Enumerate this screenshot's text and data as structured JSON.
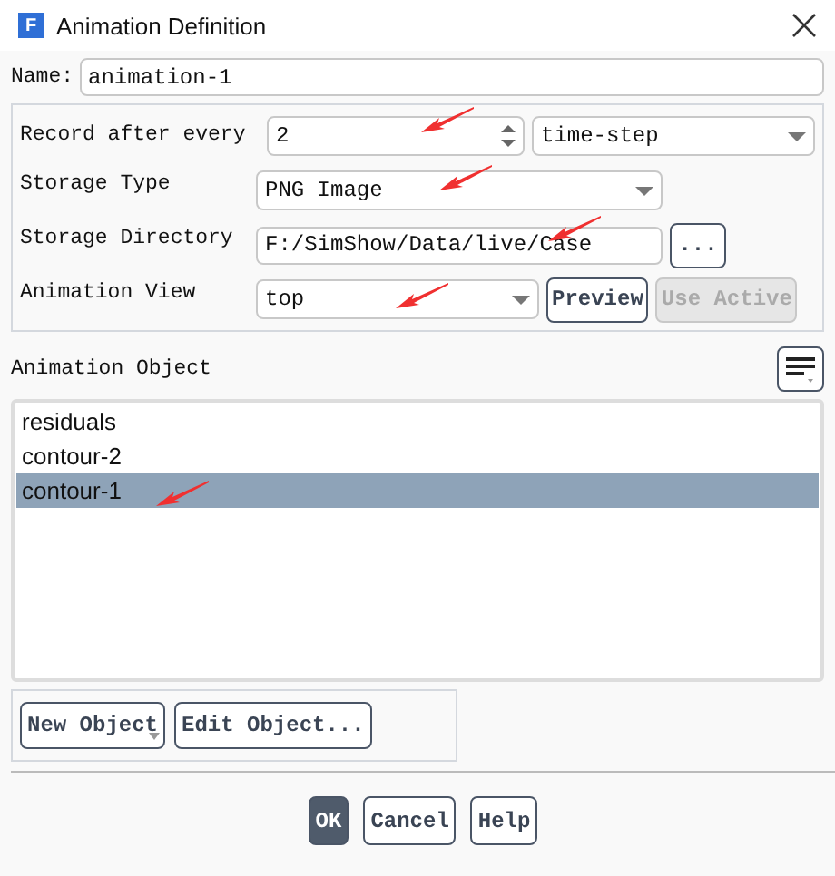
{
  "window": {
    "title": "Animation Definition",
    "app_icon": "F"
  },
  "name": {
    "label": "Name:",
    "value": "animation-1"
  },
  "record": {
    "label": "Record after every",
    "value": "2",
    "unit": "time-step"
  },
  "storage_type": {
    "label": "Storage Type",
    "value": "PNG Image"
  },
  "storage_directory": {
    "label": "Storage Directory",
    "value": "F:/SimShow/Data/live/Case",
    "browse": "..."
  },
  "animation_view": {
    "label": "Animation View",
    "value": "top",
    "buttons": [
      {
        "label": "Preview",
        "disabled": false
      },
      {
        "label": "Use Active",
        "disabled": true
      }
    ]
  },
  "object_list": {
    "label": "Animation Object",
    "items": [
      {
        "label": "residuals",
        "selected": false
      },
      {
        "label": "contour-2",
        "selected": false
      },
      {
        "label": "contour-1",
        "selected": true
      }
    ]
  },
  "object_buttons": [
    {
      "label": "New Object",
      "kind": "menu"
    },
    {
      "label": "Edit Object...",
      "kind": "plain"
    }
  ],
  "buttons": [
    {
      "label": "OK",
      "default": true
    },
    {
      "label": "Cancel",
      "default": false
    },
    {
      "label": "Help",
      "default": false
    }
  ]
}
